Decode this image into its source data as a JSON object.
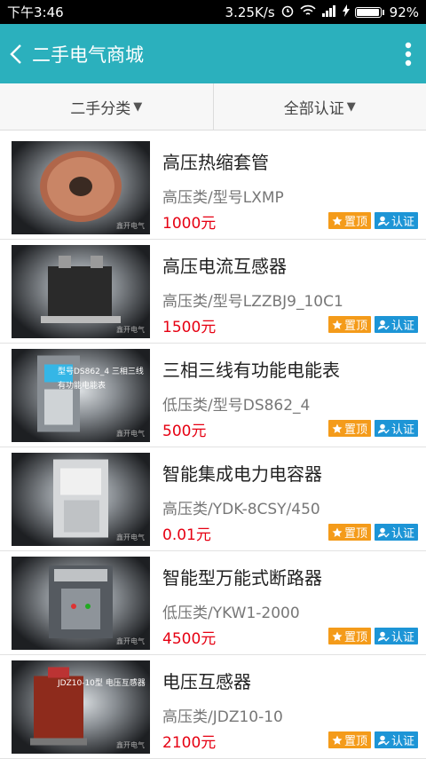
{
  "status": {
    "time": "下午3:46",
    "speed": "3.25K/s",
    "battery": "92%",
    "battery_level": 0.92
  },
  "header": {
    "title": "二手电气商城"
  },
  "filters": [
    {
      "label": "二手分类"
    },
    {
      "label": "全部认证"
    }
  ],
  "badges": {
    "top": "置顶",
    "cert": "认证"
  },
  "items": [
    {
      "name": "高压热缩套管",
      "model": "高压类/型号LXMP",
      "price": "1000元",
      "image": "coil",
      "caption": ""
    },
    {
      "name": "高压电流互感器",
      "model": "高压类/型号LZZBJ9_10C1",
      "price": "1500元",
      "image": "transformer",
      "caption": ""
    },
    {
      "name": "三相三线有功能电能表",
      "model": "低压类/型号DS862_4",
      "price": "500元",
      "image": "meter",
      "caption": "型号DS862_4 三相三线有功能电能表"
    },
    {
      "name": "智能集成电力电容器",
      "model": "高压类/YDK-8CSY/450",
      "price": "0.01元",
      "image": "capacitor",
      "caption": ""
    },
    {
      "name": "智能型万能式断路器",
      "model": "低压类/YKW1-2000",
      "price": "4500元",
      "image": "breaker",
      "caption": ""
    },
    {
      "name": "电压互感器",
      "model": "高压类/JDZ10-10",
      "price": "2100元",
      "image": "pt",
      "caption": "JDZ10-10型 电压互感器"
    }
  ],
  "watermark": "鑫开电气"
}
